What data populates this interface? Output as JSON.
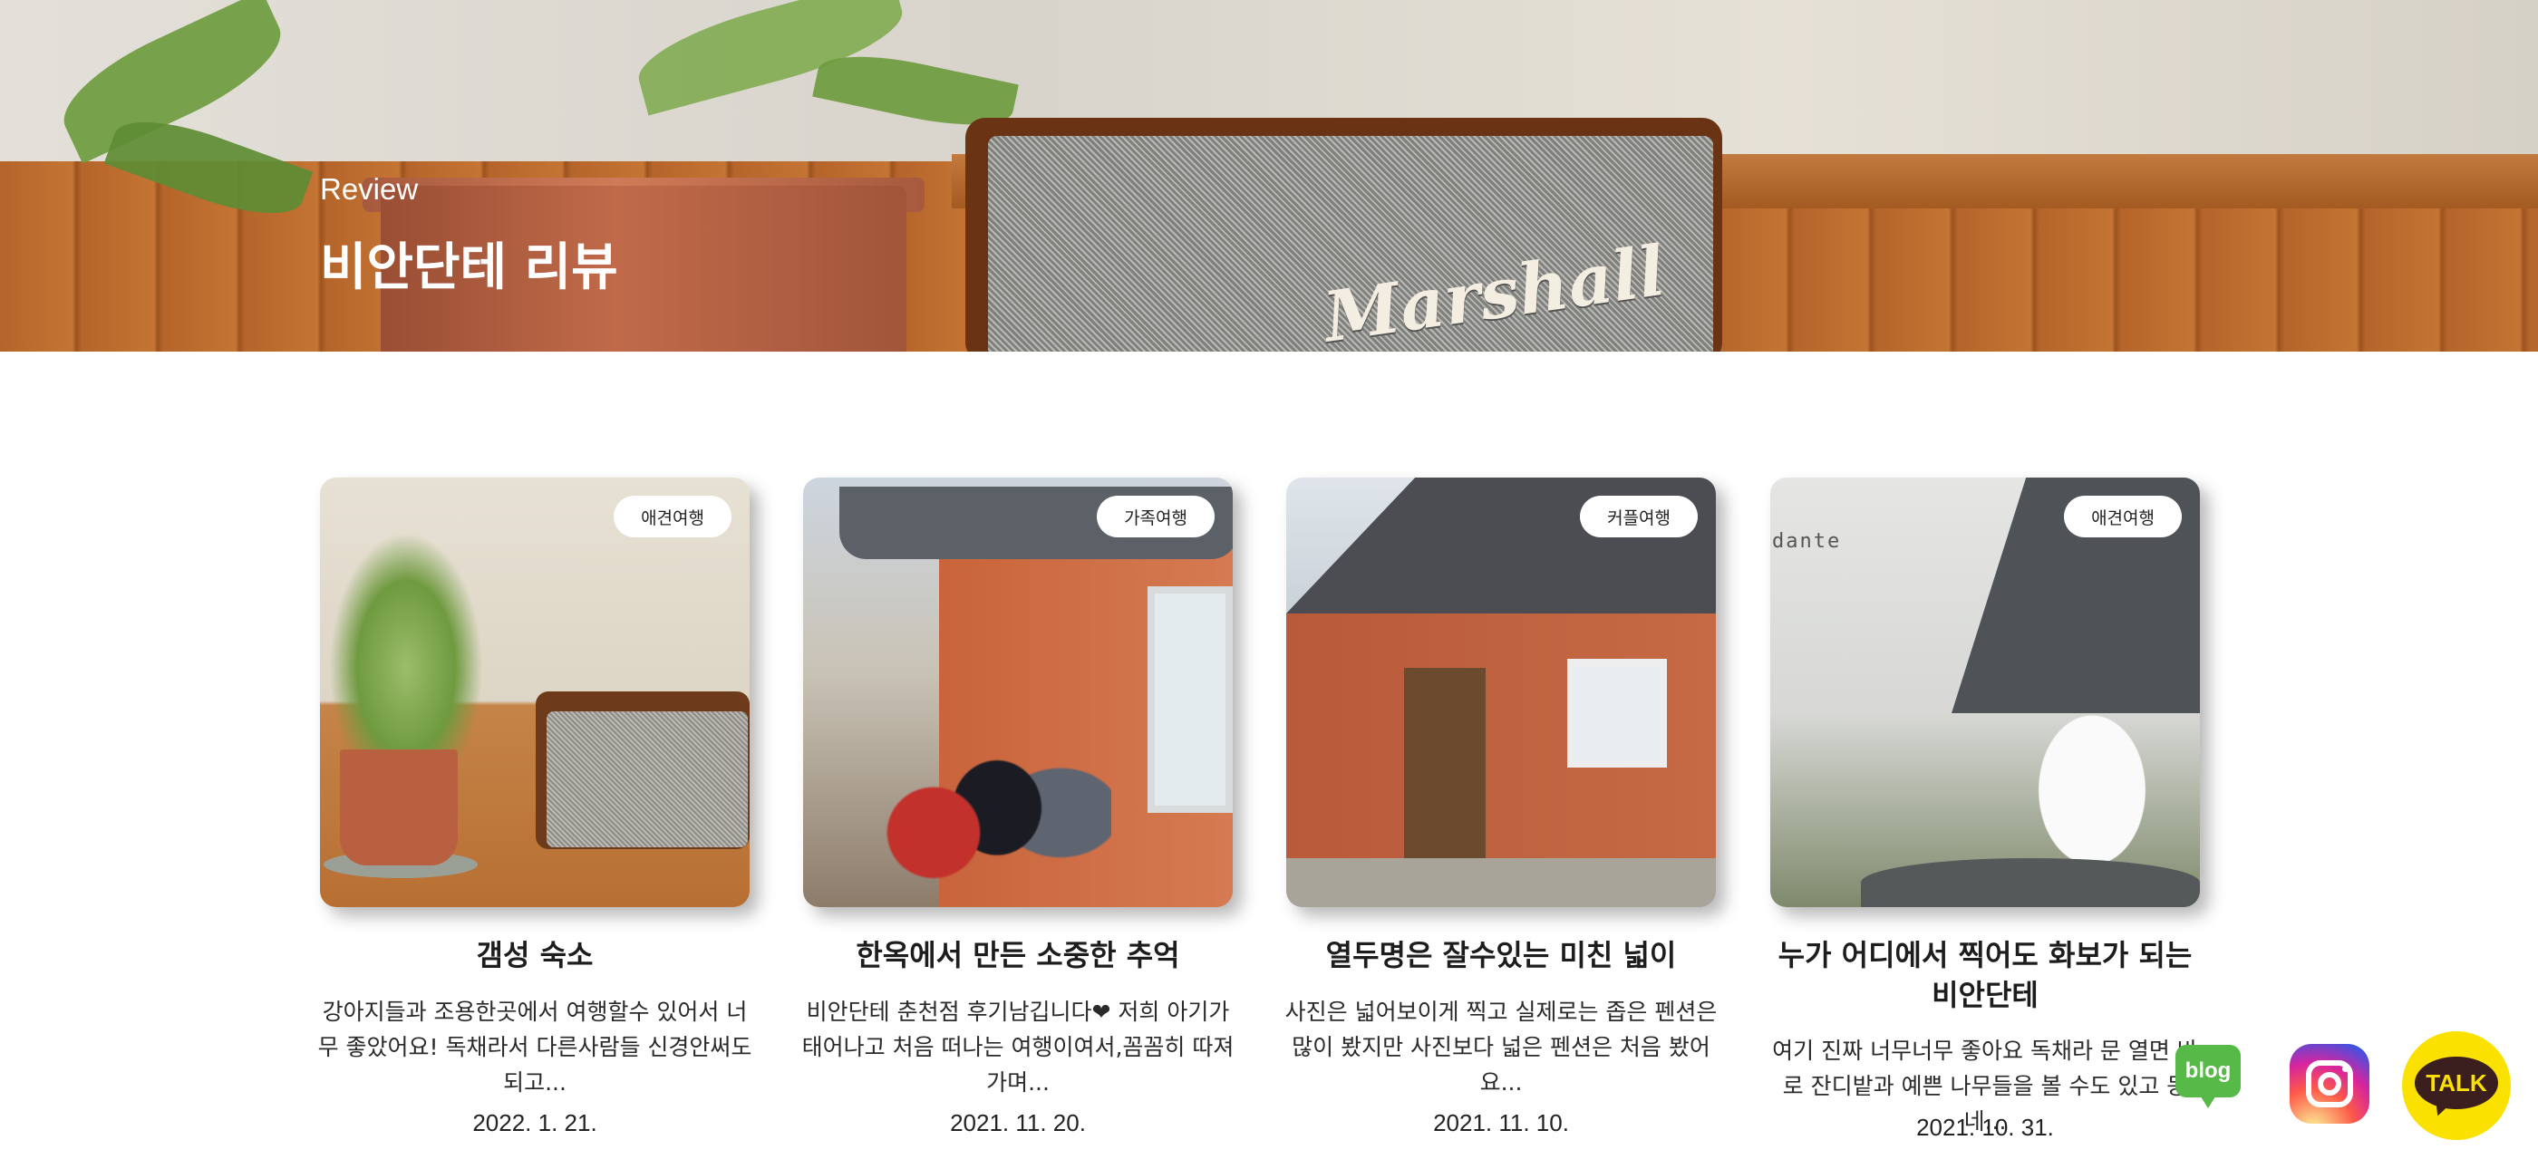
{
  "hero": {
    "subtitle": "Review",
    "title": "비안단테 리뷰",
    "speaker_brand": "Marshall"
  },
  "cards": [
    {
      "tag": "애견여행",
      "title": "갬성 숙소",
      "excerpt": "강아지들과 조용한곳에서 여행할수 있어서 너무 좋았어요! 독채라서 다른사람들 신경안써도 되고...",
      "date": "2022. 1. 21."
    },
    {
      "tag": "가족여행",
      "title": "한옥에서 만든 소중한 추억",
      "excerpt": "비안단테 춘천점 후기남깁니다❤ 저희 아기가 태어나고 처음 떠나는 여행이여서,꼼꼼히 따져가며...",
      "date": "2021. 11. 20."
    },
    {
      "tag": "커플여행",
      "title": "열두명은 잘수있는 미친 넓이",
      "excerpt": "사진은 넓어보이게 찍고 실제로는 좁은 펜션은 많이 봤지만 사진보다 넓은 펜션은 처음 봤어요...",
      "date": "2021. 11. 10."
    },
    {
      "tag": "애견여행",
      "title": "누가 어디에서 찍어도 화보가 되는 비안단테",
      "excerpt": "여기 진짜 너무너무 좋아요 독채라 문 열면 바로 잔디밭과 예쁜 나무들을 볼 수도 있고 동네...",
      "date": "2021. 10. 31.",
      "watermark": "dante"
    }
  ],
  "floating": {
    "blog_label": "blog",
    "talk_label": "TALK",
    "blog_color": "#57b947",
    "talk_color": "#fae100"
  }
}
